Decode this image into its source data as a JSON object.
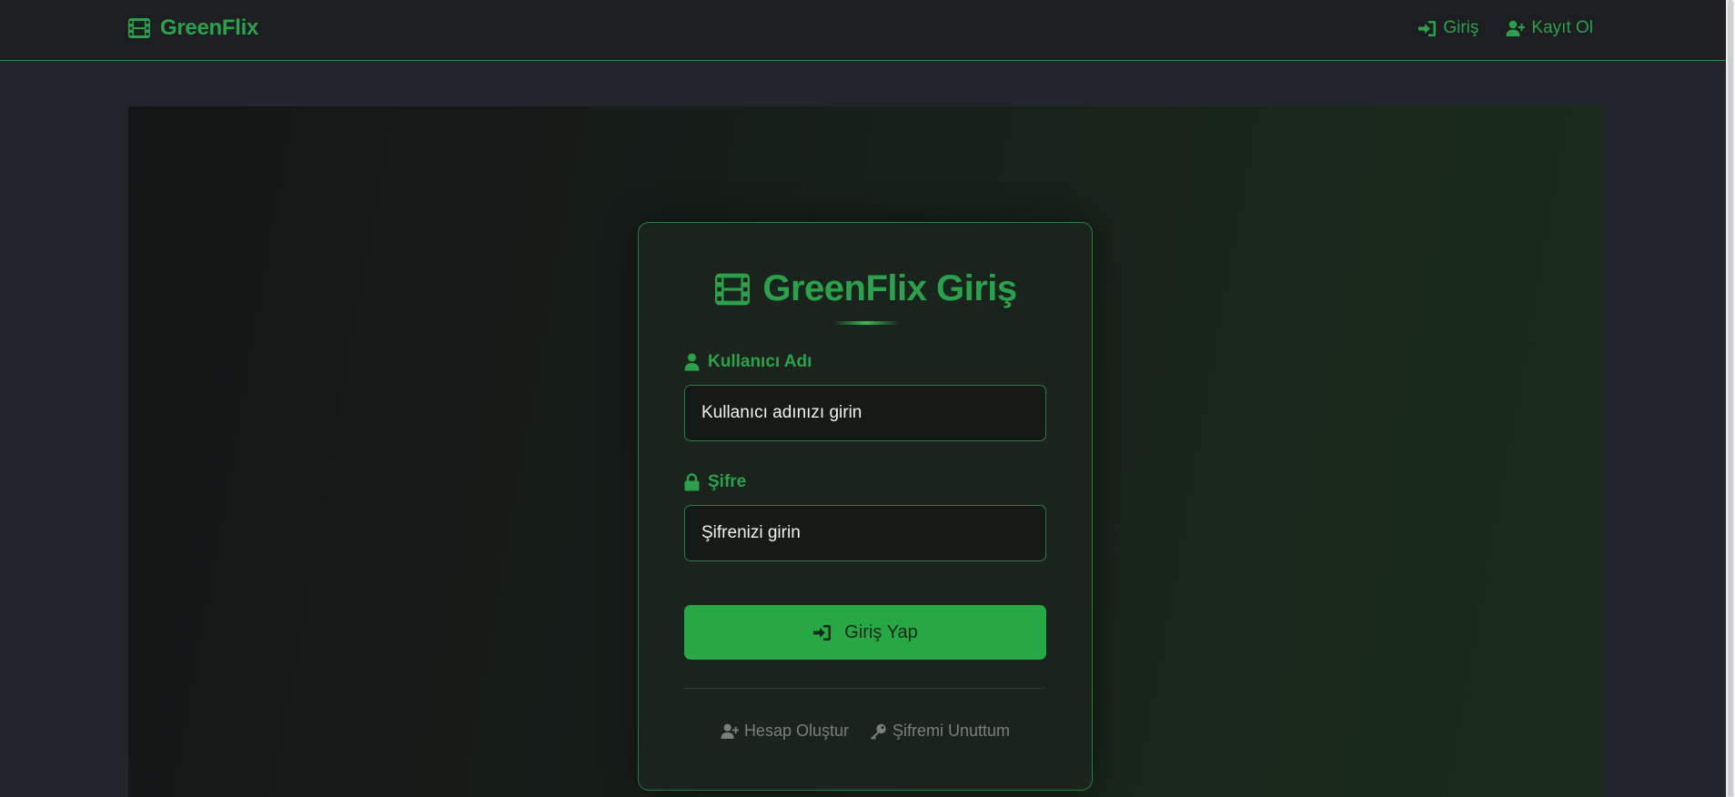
{
  "navbar": {
    "brand": "GreenFlix",
    "brand_icon": "film-icon",
    "links": [
      {
        "label": "Giriş",
        "icon": "sign-in-icon"
      },
      {
        "label": "Kayıt Ol",
        "icon": "user-plus-icon"
      }
    ]
  },
  "login_card": {
    "title": "GreenFlix Giriş",
    "username": {
      "label": "Kullanıcı Adı",
      "icon": "user-icon",
      "placeholder": "Kullanıcı adınızı girin"
    },
    "password": {
      "label": "Şifre",
      "icon": "lock-icon",
      "placeholder": "Şifrenizi girin"
    },
    "submit_label": "Giriş Yap",
    "footer_links": [
      {
        "label": "Hesap Oluştur",
        "icon": "user-plus-icon"
      },
      {
        "label": "Şifremi Unuttum",
        "icon": "key-icon"
      }
    ]
  },
  "colors": {
    "accent": "#2aa24d",
    "button": "#28a745",
    "navbar_bg": "#1d1e21",
    "page_bg": "#22252b",
    "card_bg": "#1b231d",
    "muted_text": "#7a7f7b"
  }
}
